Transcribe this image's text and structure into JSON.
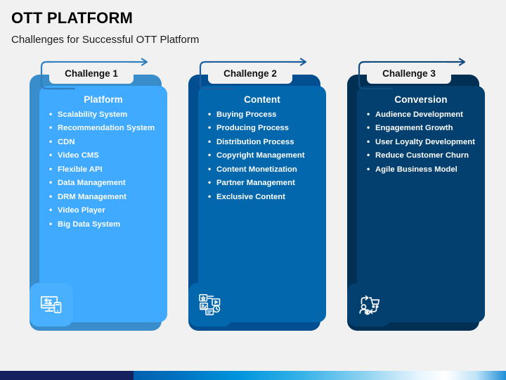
{
  "header": {
    "title": "OTT PLATFORM",
    "subtitle": "Challenges for Successful OTT Platform"
  },
  "colors": {
    "page_background": "#f1f1f1",
    "bar_navy": "#16205e",
    "bar_blue": "#0094dd",
    "label_stroke": "#2f7fc1",
    "label_stroke_dark": "#134a7d"
  },
  "columns": [
    {
      "label": "Challenge 1",
      "panel_title": "Platform",
      "outer_color": "#3a8dcb",
      "inner_color": "#3faaff",
      "badge_color": "#48b0ff",
      "stroke_color": "#2f7fc1",
      "icon": "devices-sync-icon",
      "items": [
        "Scalability System",
        "Recommendation System",
        "CDN",
        "Video CMS",
        "Flexible API",
        "Data Management",
        "DRM Management",
        "Video Player",
        "Big Data System"
      ]
    },
    {
      "label": "Challenge 2",
      "panel_title": "Content",
      "outer_color": "#014f91",
      "inner_color": "#0367ae",
      "badge_color": "#0367ae",
      "stroke_color": "#1c5f9e",
      "icon": "media-content-icon",
      "items": [
        "Buying Process",
        "Producing Process",
        "Distribution Process",
        "Copyright Management",
        "Content Monetization",
        "Partner Management",
        "Exclusive Content"
      ]
    },
    {
      "label": "Challenge 3",
      "panel_title": "Conversion",
      "outer_color": "#022f54",
      "inner_color": "#03406f",
      "badge_color": "#03406f",
      "stroke_color": "#134a7d",
      "icon": "customer-cart-conversion-icon",
      "items": [
        "Audience Development",
        "Engagement Growth",
        "User Loyalty Development",
        "Reduce Customer Churn",
        "Agile Business Model"
      ]
    }
  ]
}
